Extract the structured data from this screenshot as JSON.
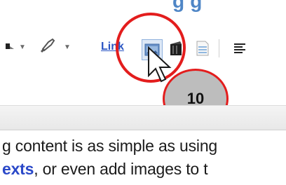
{
  "title_fragment": "g  g",
  "toolbar": {
    "link_label": "Link"
  },
  "callout": {
    "number": "10"
  },
  "content": {
    "line1": "g content is as simple as using",
    "line2_link": "exts",
    "line2_rest": ", or even add images to t"
  }
}
